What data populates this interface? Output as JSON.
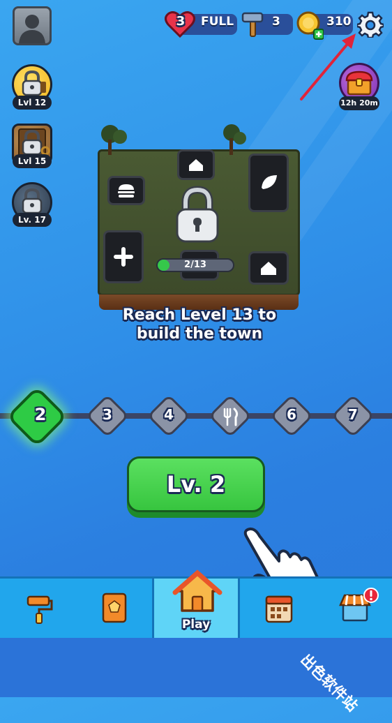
{
  "resources": {
    "lives_count": "3",
    "lives_status": "FULL",
    "hammers": "3",
    "coins": "310"
  },
  "side_locks": [
    {
      "label": "Lvl 12"
    },
    {
      "label": "Lvl 15"
    },
    {
      "label": "Lv. 17"
    }
  ],
  "chest_timer": "12h 20m",
  "town": {
    "progress_text": "2/13",
    "progress_fraction": 0.1538,
    "message_line1": "Reach Level 13 to",
    "message_line2": "build the town"
  },
  "level_path": {
    "nodes": [
      "2",
      "3",
      "4",
      "",
      "6",
      "7"
    ],
    "current": "2"
  },
  "play_button": "Lv. 2",
  "bottom_nav": {
    "play_label": "Play"
  },
  "watermark": "出色软件站",
  "colors": {
    "accent_green": "#33d24a",
    "background": "#2f8fe8",
    "nav_bar": "#21a6ec"
  }
}
